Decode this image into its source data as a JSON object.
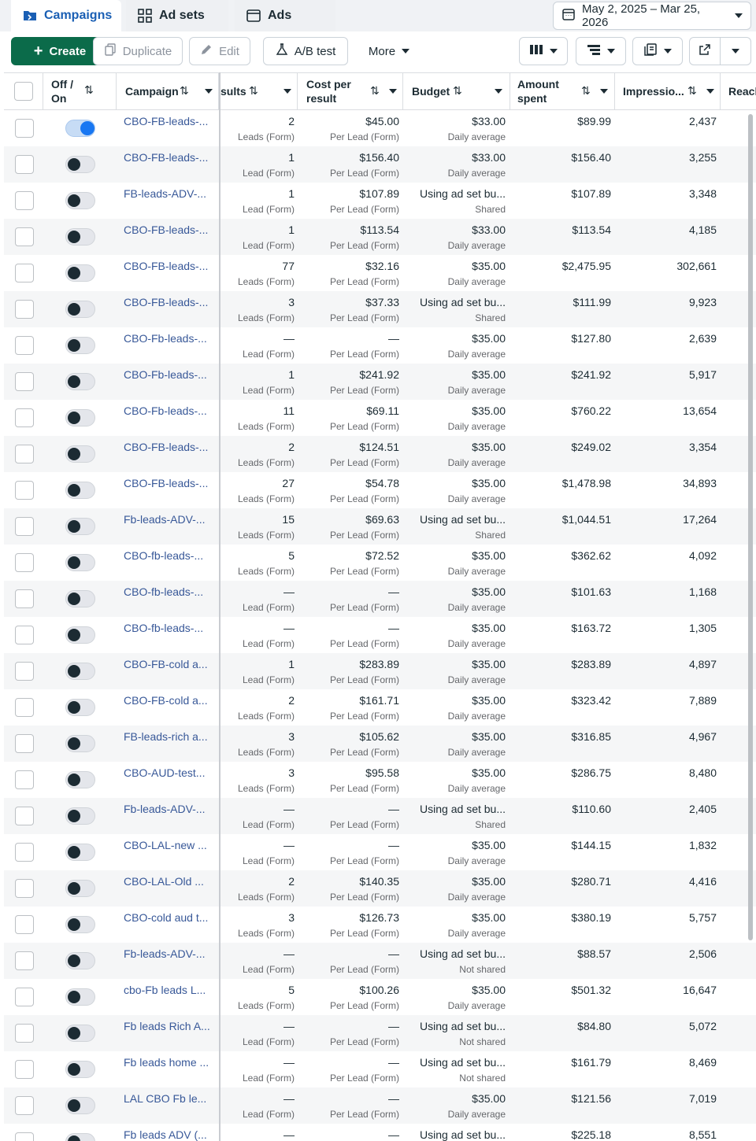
{
  "tabs": [
    {
      "label": "Campaigns",
      "icon": "folder-icon",
      "active": true
    },
    {
      "label": "Ad sets",
      "icon": "grid-icon",
      "active": false
    },
    {
      "label": "Ads",
      "icon": "ad-icon",
      "active": false
    }
  ],
  "date_range": "May 2, 2025 – Mar 25, 2026",
  "toolbar": {
    "create": "Create",
    "duplicate": "Duplicate",
    "edit": "Edit",
    "ab_test": "A/B test",
    "more": "More"
  },
  "headers": {
    "off_on": [
      "Off /",
      "On"
    ],
    "campaign": "Campaign",
    "results": "sults",
    "cost_per_result": [
      "Cost per",
      "result"
    ],
    "budget": "Budget",
    "amount_spent": [
      "Amount",
      "spent"
    ],
    "impressions": "Impressio...",
    "reach": "Reacl"
  },
  "rows": [
    {
      "on": true,
      "campaign": "CBO-FB-leads-...",
      "results": "2",
      "results_sub": "Leads (Form)",
      "cpr": "$45.00",
      "budget": "$33.00",
      "budget_sub": "Daily average",
      "spent": "$89.99",
      "impr": "2,437"
    },
    {
      "on": false,
      "campaign": "CBO-FB-leads-...",
      "results": "1",
      "results_sub": "Lead (Form)",
      "cpr": "$156.40",
      "budget": "$33.00",
      "budget_sub": "Daily average",
      "spent": "$156.40",
      "impr": "3,255"
    },
    {
      "on": false,
      "campaign": "FB-leads-ADV-...",
      "results": "1",
      "results_sub": "Lead (Form)",
      "cpr": "$107.89",
      "budget": "Using ad set bu...",
      "budget_sub": "Shared",
      "spent": "$107.89",
      "impr": "3,348"
    },
    {
      "on": false,
      "campaign": "CBO-FB-leads-...",
      "results": "1",
      "results_sub": "Lead (Form)",
      "cpr": "$113.54",
      "budget": "$33.00",
      "budget_sub": "Daily average",
      "spent": "$113.54",
      "impr": "4,185"
    },
    {
      "on": false,
      "campaign": "CBO-FB-leads-...",
      "results": "77",
      "results_sub": "Leads (Form)",
      "cpr": "$32.16",
      "budget": "$35.00",
      "budget_sub": "Daily average",
      "spent": "$2,475.95",
      "impr": "302,661"
    },
    {
      "on": false,
      "campaign": "CBO-FB-leads-...",
      "results": "3",
      "results_sub": "Leads (Form)",
      "cpr": "$37.33",
      "budget": "Using ad set bu...",
      "budget_sub": "Shared",
      "spent": "$111.99",
      "impr": "9,923"
    },
    {
      "on": false,
      "campaign": "CBO-Fb-leads-...",
      "results": "—",
      "results_sub": "Lead (Form)",
      "cpr": "—",
      "budget": "$35.00",
      "budget_sub": "Daily average",
      "spent": "$127.80",
      "impr": "2,639"
    },
    {
      "on": false,
      "campaign": "CBO-Fb-leads-...",
      "results": "1",
      "results_sub": "Lead (Form)",
      "cpr": "$241.92",
      "budget": "$35.00",
      "budget_sub": "Daily average",
      "spent": "$241.92",
      "impr": "5,917"
    },
    {
      "on": false,
      "campaign": "CBO-Fb-leads-...",
      "results": "11",
      "results_sub": "Leads (Form)",
      "cpr": "$69.11",
      "budget": "$35.00",
      "budget_sub": "Daily average",
      "spent": "$760.22",
      "impr": "13,654"
    },
    {
      "on": false,
      "campaign": "CBO-FB-leads-...",
      "results": "2",
      "results_sub": "Leads (Form)",
      "cpr": "$124.51",
      "budget": "$35.00",
      "budget_sub": "Daily average",
      "spent": "$249.02",
      "impr": "3,354"
    },
    {
      "on": false,
      "campaign": "CBO-FB-leads-...",
      "results": "27",
      "results_sub": "Leads (Form)",
      "cpr": "$54.78",
      "budget": "$35.00",
      "budget_sub": "Daily average",
      "spent": "$1,478.98",
      "impr": "34,893"
    },
    {
      "on": false,
      "campaign": "Fb-leads-ADV-...",
      "results": "15",
      "results_sub": "Leads (Form)",
      "cpr": "$69.63",
      "budget": "Using ad set bu...",
      "budget_sub": "Shared",
      "spent": "$1,044.51",
      "impr": "17,264"
    },
    {
      "on": false,
      "campaign": "CBO-fb-leads-...",
      "results": "5",
      "results_sub": "Leads (Form)",
      "cpr": "$72.52",
      "budget": "$35.00",
      "budget_sub": "Daily average",
      "spent": "$362.62",
      "impr": "4,092"
    },
    {
      "on": false,
      "campaign": "CBO-fb-leads-...",
      "results": "—",
      "results_sub": "Lead (Form)",
      "cpr": "—",
      "budget": "$35.00",
      "budget_sub": "Daily average",
      "spent": "$101.63",
      "impr": "1,168"
    },
    {
      "on": false,
      "campaign": "CBO-fb-leads-...",
      "results": "—",
      "results_sub": "Lead (Form)",
      "cpr": "—",
      "budget": "$35.00",
      "budget_sub": "Daily average",
      "spent": "$163.72",
      "impr": "1,305"
    },
    {
      "on": false,
      "campaign": "CBO-FB-cold a...",
      "results": "1",
      "results_sub": "Lead (Form)",
      "cpr": "$283.89",
      "budget": "$35.00",
      "budget_sub": "Daily average",
      "spent": "$283.89",
      "impr": "4,897"
    },
    {
      "on": false,
      "campaign": "CBO-FB-cold a...",
      "results": "2",
      "results_sub": "Leads (Form)",
      "cpr": "$161.71",
      "budget": "$35.00",
      "budget_sub": "Daily average",
      "spent": "$323.42",
      "impr": "7,889"
    },
    {
      "on": false,
      "campaign": "FB-leads-rich a...",
      "results": "3",
      "results_sub": "Leads (Form)",
      "cpr": "$105.62",
      "budget": "$35.00",
      "budget_sub": "Daily average",
      "spent": "$316.85",
      "impr": "4,967"
    },
    {
      "on": false,
      "campaign": "CBO-AUD-test...",
      "results": "3",
      "results_sub": "Leads (Form)",
      "cpr": "$95.58",
      "budget": "$35.00",
      "budget_sub": "Daily average",
      "spent": "$286.75",
      "impr": "8,480"
    },
    {
      "on": false,
      "campaign": "Fb-leads-ADV-...",
      "results": "—",
      "results_sub": "Lead (Form)",
      "cpr": "—",
      "budget": "Using ad set bu...",
      "budget_sub": "Shared",
      "spent": "$110.60",
      "impr": "2,405"
    },
    {
      "on": false,
      "campaign": "CBO-LAL-new ...",
      "results": "—",
      "results_sub": "Lead (Form)",
      "cpr": "—",
      "budget": "$35.00",
      "budget_sub": "Daily average",
      "spent": "$144.15",
      "impr": "1,832"
    },
    {
      "on": false,
      "campaign": "CBO-LAL-Old ...",
      "results": "2",
      "results_sub": "Leads (Form)",
      "cpr": "$140.35",
      "budget": "$35.00",
      "budget_sub": "Daily average",
      "spent": "$280.71",
      "impr": "4,416"
    },
    {
      "on": false,
      "campaign": "CBO-cold aud t...",
      "results": "3",
      "results_sub": "Leads (Form)",
      "cpr": "$126.73",
      "budget": "$35.00",
      "budget_sub": "Daily average",
      "spent": "$380.19",
      "impr": "5,757"
    },
    {
      "on": false,
      "campaign": "Fb-leads-ADV-...",
      "results": "—",
      "results_sub": "Lead (Form)",
      "cpr": "—",
      "budget": "Using ad set bu...",
      "budget_sub": "Not shared",
      "spent": "$88.57",
      "impr": "2,506"
    },
    {
      "on": false,
      "campaign": "cbo-Fb leads L...",
      "results": "5",
      "results_sub": "Leads (Form)",
      "cpr": "$100.26",
      "budget": "$35.00",
      "budget_sub": "Daily average",
      "spent": "$501.32",
      "impr": "16,647"
    },
    {
      "on": false,
      "campaign": "Fb leads Rich A...",
      "results": "—",
      "results_sub": "Lead (Form)",
      "cpr": "—",
      "budget": "Using ad set bu...",
      "budget_sub": "Not shared",
      "spent": "$84.80",
      "impr": "5,072"
    },
    {
      "on": false,
      "campaign": "Fb leads home ...",
      "results": "—",
      "results_sub": "Lead (Form)",
      "cpr": "—",
      "budget": "Using ad set bu...",
      "budget_sub": "Not shared",
      "spent": "$161.79",
      "impr": "8,469"
    },
    {
      "on": false,
      "campaign": "LAL CBO Fb le...",
      "results": "—",
      "results_sub": "Lead (Form)",
      "cpr": "—",
      "budget": "$35.00",
      "budget_sub": "Daily average",
      "spent": "$121.56",
      "impr": "7,019"
    },
    {
      "on": false,
      "campaign": "Fb leads ADV (...",
      "results": "—",
      "results_sub": "Lead (Form)",
      "cpr": "—",
      "budget": "Using ad set bu...",
      "budget_sub": "Shared",
      "spent": "$225.18",
      "impr": "8,551"
    }
  ],
  "cpr_sub": "Per Lead (Form)",
  "colors": {
    "primary": "#0b6b4a",
    "link": "#385898",
    "active_tab": "#1a5fb4",
    "toggle_on": "#1877f2"
  }
}
